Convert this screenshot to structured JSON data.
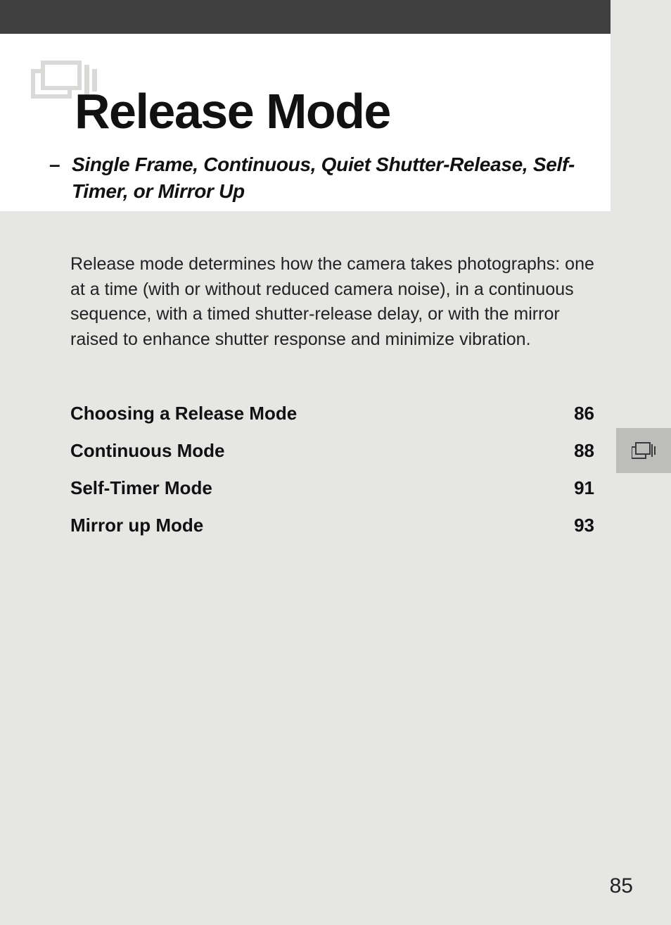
{
  "header": {
    "title": "Release Mode",
    "subtitle_dash": "–",
    "subtitle": "Single Frame, Continuous, Quiet Shutter-Release, Self-Timer, or Mirror Up"
  },
  "intro": "Release mode determines how the camera takes photographs: one at a time (with or without reduced camera noise), in a continuous sequence, with a timed shutter-release delay, or with the mirror raised to enhance shutter response and minimize vibration.",
  "toc": [
    {
      "label": "Choosing a Release Mode",
      "page": "86"
    },
    {
      "label": "Continuous Mode",
      "page": "88"
    },
    {
      "label": "Self-Timer Mode",
      "page": "91"
    },
    {
      "label": "Mirror up Mode",
      "page": "93"
    }
  ],
  "page_number": "85"
}
